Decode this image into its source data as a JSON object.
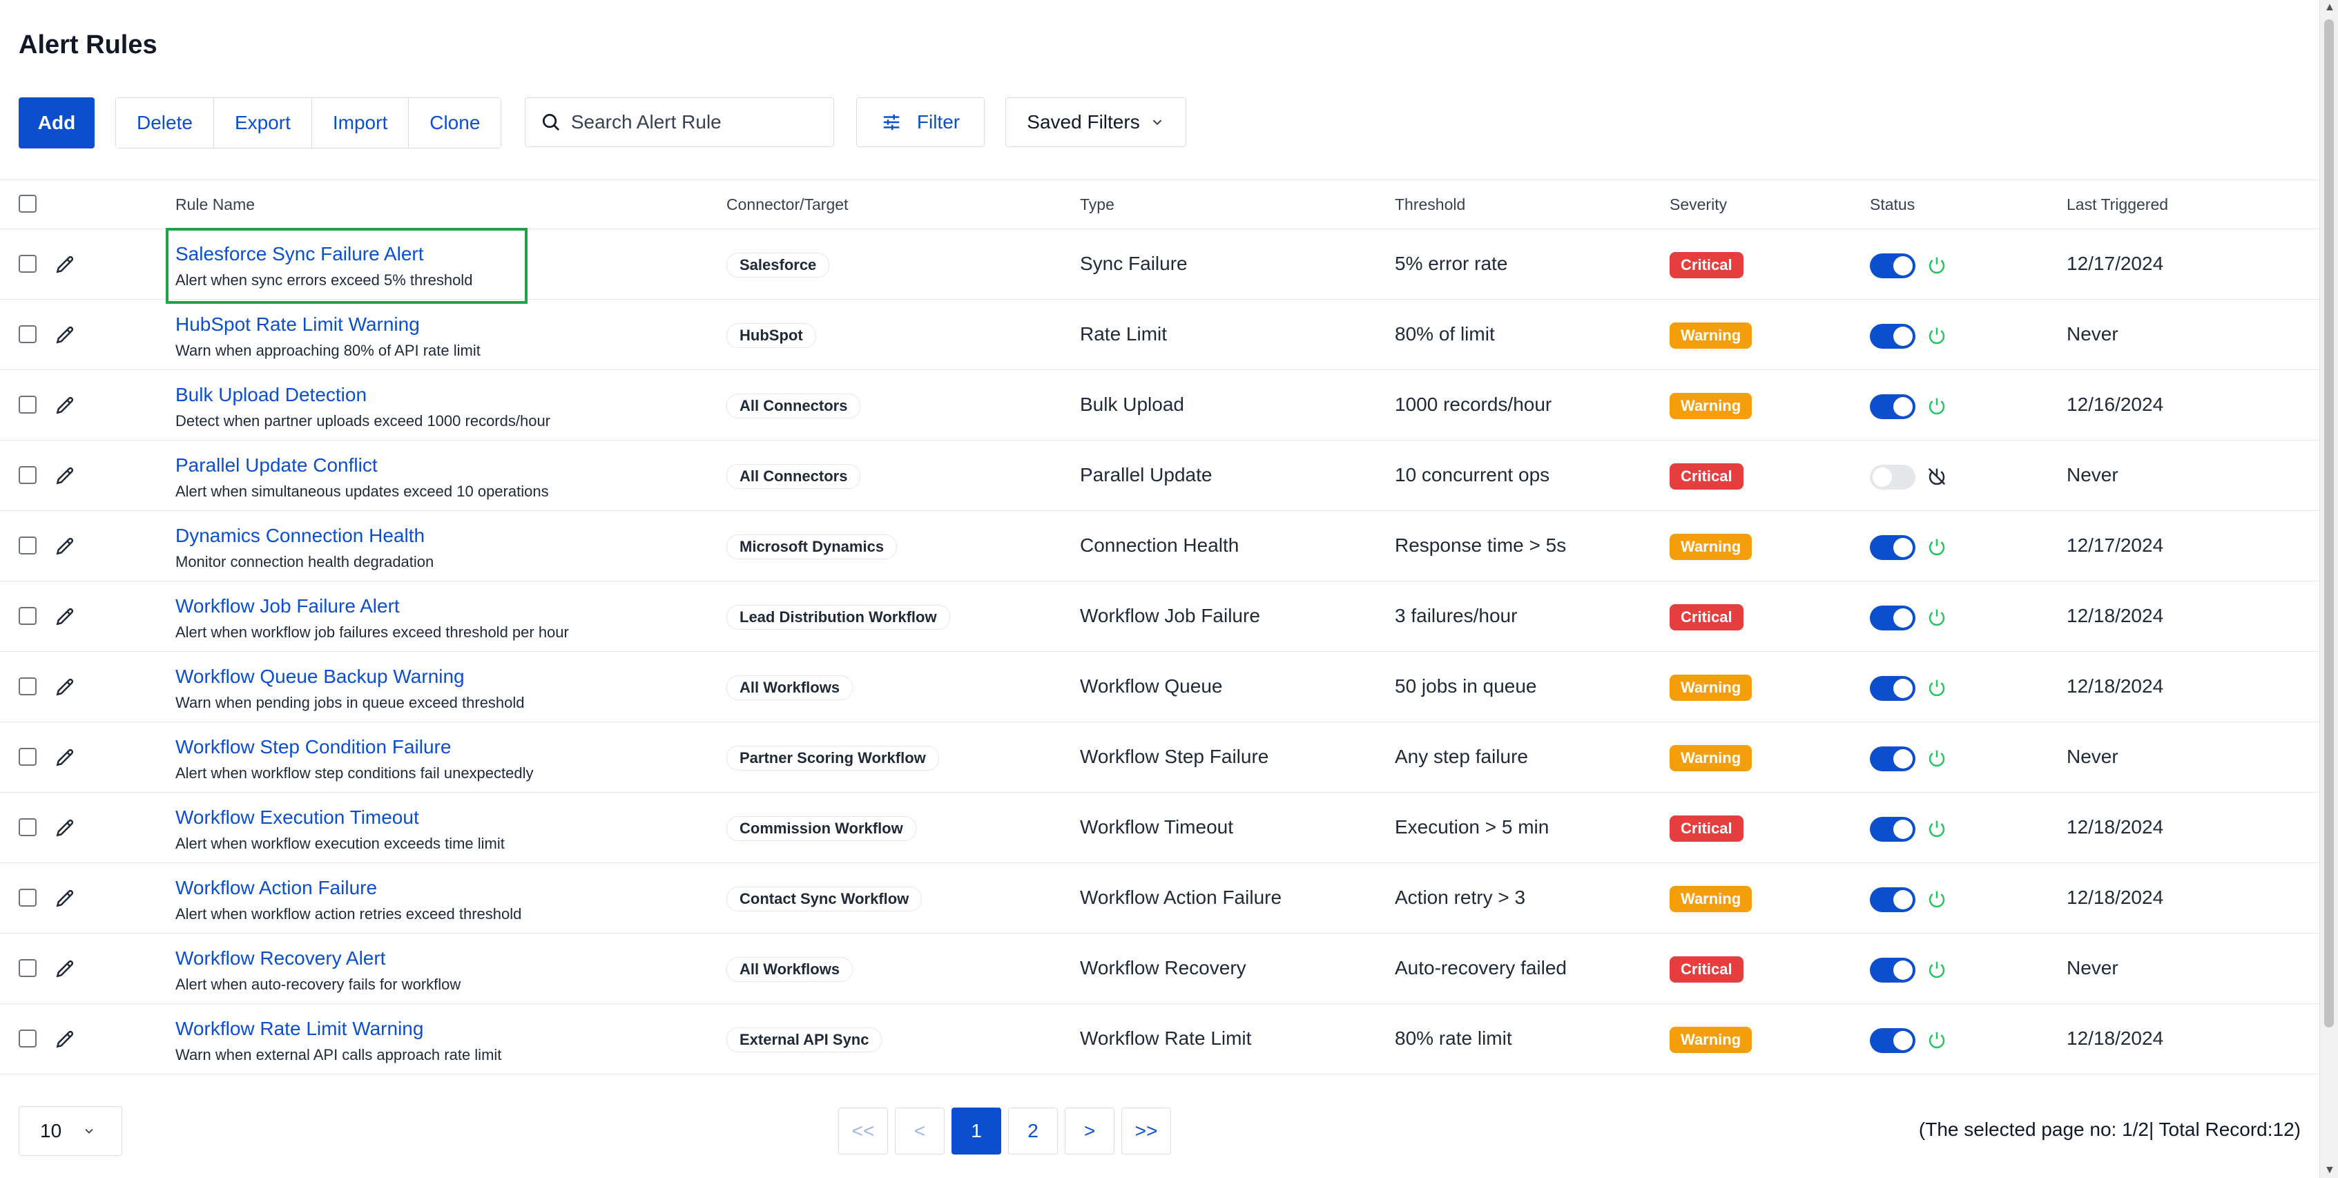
{
  "page": {
    "title": "Alert Rules"
  },
  "toolbar": {
    "add": "Add",
    "delete": "Delete",
    "export": "Export",
    "import": "Import",
    "clone": "Clone",
    "search_placeholder": "Search Alert Rule",
    "filter": "Filter",
    "saved_filters": "Saved Filters"
  },
  "table": {
    "headers": {
      "rule_name": "Rule Name",
      "connector": "Connector/Target",
      "type": "Type",
      "threshold": "Threshold",
      "severity": "Severity",
      "status": "Status",
      "last_triggered": "Last Triggered"
    },
    "rows": [
      {
        "name": "Salesforce Sync Failure Alert",
        "desc": "Alert when sync errors exceed 5% threshold",
        "connector": "Salesforce",
        "type": "Sync Failure",
        "threshold": "5% error rate",
        "severity": "Critical",
        "enabled": true,
        "last": "12/17/2024"
      },
      {
        "name": "HubSpot Rate Limit Warning",
        "desc": "Warn when approaching 80% of API rate limit",
        "connector": "HubSpot",
        "type": "Rate Limit",
        "threshold": "80% of limit",
        "severity": "Warning",
        "enabled": true,
        "last": "Never"
      },
      {
        "name": "Bulk Upload Detection",
        "desc": "Detect when partner uploads exceed 1000 records/hour",
        "connector": "All Connectors",
        "type": "Bulk Upload",
        "threshold": "1000 records/hour",
        "severity": "Warning",
        "enabled": true,
        "last": "12/16/2024"
      },
      {
        "name": "Parallel Update Conflict",
        "desc": "Alert when simultaneous updates exceed 10 operations",
        "connector": "All Connectors",
        "type": "Parallel Update",
        "threshold": "10 concurrent ops",
        "severity": "Critical",
        "enabled": false,
        "last": "Never"
      },
      {
        "name": "Dynamics Connection Health",
        "desc": "Monitor connection health degradation",
        "connector": "Microsoft Dynamics",
        "type": "Connection Health",
        "threshold": "Response time > 5s",
        "severity": "Warning",
        "enabled": true,
        "last": "12/17/2024"
      },
      {
        "name": "Workflow Job Failure Alert",
        "desc": "Alert when workflow job failures exceed threshold per hour",
        "connector": "Lead Distribution Workflow",
        "type": "Workflow Job Failure",
        "threshold": "3 failures/hour",
        "severity": "Critical",
        "enabled": true,
        "last": "12/18/2024"
      },
      {
        "name": "Workflow Queue Backup Warning",
        "desc": "Warn when pending jobs in queue exceed threshold",
        "connector": "All Workflows",
        "type": "Workflow Queue",
        "threshold": "50 jobs in queue",
        "severity": "Warning",
        "enabled": true,
        "last": "12/18/2024"
      },
      {
        "name": "Workflow Step Condition Failure",
        "desc": "Alert when workflow step conditions fail unexpectedly",
        "connector": "Partner Scoring Workflow",
        "type": "Workflow Step Failure",
        "threshold": "Any step failure",
        "severity": "Warning",
        "enabled": true,
        "last": "Never"
      },
      {
        "name": "Workflow Execution Timeout",
        "desc": "Alert when workflow execution exceeds time limit",
        "connector": "Commission Workflow",
        "type": "Workflow Timeout",
        "threshold": "Execution > 5 min",
        "severity": "Critical",
        "enabled": true,
        "last": "12/18/2024"
      },
      {
        "name": "Workflow Action Failure",
        "desc": "Alert when workflow action retries exceed threshold",
        "connector": "Contact Sync Workflow",
        "type": "Workflow Action Failure",
        "threshold": "Action retry > 3",
        "severity": "Warning",
        "enabled": true,
        "last": "12/18/2024"
      },
      {
        "name": "Workflow Recovery Alert",
        "desc": "Alert when auto-recovery fails for workflow",
        "connector": "All Workflows",
        "type": "Workflow Recovery",
        "threshold": "Auto-recovery failed",
        "severity": "Critical",
        "enabled": true,
        "last": "Never"
      },
      {
        "name": "Workflow Rate Limit Warning",
        "desc": "Warn when external API calls approach rate limit",
        "connector": "External API Sync",
        "type": "Workflow Rate Limit",
        "threshold": "80% rate limit",
        "severity": "Warning",
        "enabled": true,
        "last": "12/18/2024"
      }
    ]
  },
  "footer": {
    "page_size": "10",
    "pager": {
      "first": "<<",
      "prev": "<",
      "pages": [
        "1",
        "2"
      ],
      "next": ">",
      "last": ">>"
    },
    "page_info": "(The selected page no: 1/2| Total Record:12)"
  },
  "colors": {
    "accent": "#0b4fcf",
    "critical": "#e53e3e",
    "warning": "#f59e0b",
    "active_power": "#22c55e",
    "highlight": "#22a04a"
  },
  "icons": {
    "search": "search-icon",
    "filter": "sliders-icon",
    "dropdown": "chevron-down-icon",
    "edit": "pencil-icon",
    "power_on": "power-icon",
    "power_off": "power-off-icon"
  }
}
